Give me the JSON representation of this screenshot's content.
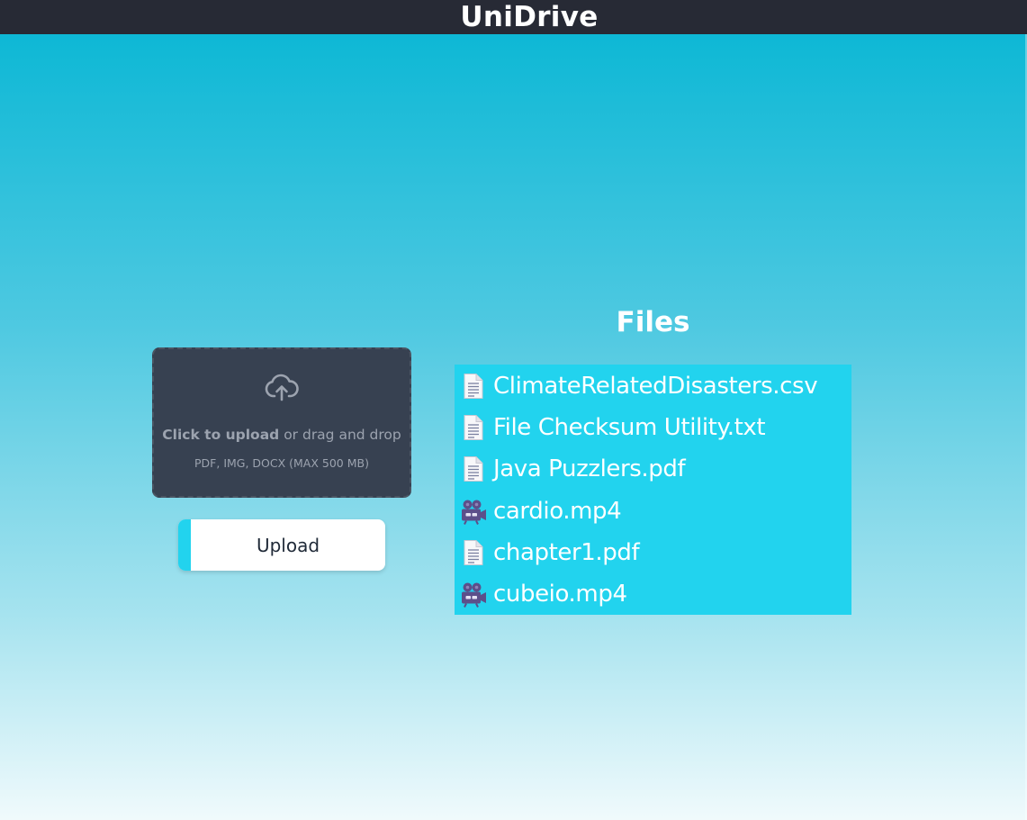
{
  "app": {
    "title": "UniDrive"
  },
  "upload": {
    "dropzone": {
      "icon": "cloud-upload-icon",
      "click_text": "Click to upload",
      "drag_text": " or drag and drop",
      "hint": "PDF, IMG, DOCX (MAX 500 MB)"
    },
    "button_label": "Upload"
  },
  "files": {
    "heading": "Files",
    "items": [
      {
        "name": "ClimateRelatedDisasters.csv",
        "icon": "document-icon"
      },
      {
        "name": "File Checksum Utility.txt",
        "icon": "document-icon"
      },
      {
        "name": "Java Puzzlers.pdf",
        "icon": "document-icon"
      },
      {
        "name": "cardio.mp4",
        "icon": "movie-camera-icon"
      },
      {
        "name": "chapter1.pdf",
        "icon": "document-icon"
      },
      {
        "name": "cubeio.mp4",
        "icon": "movie-camera-icon"
      }
    ]
  },
  "colors": {
    "topbar": "#272a35",
    "dropzone_bg": "#374151",
    "accent": "#22d3ee",
    "list_bg": "#22d3ee"
  }
}
